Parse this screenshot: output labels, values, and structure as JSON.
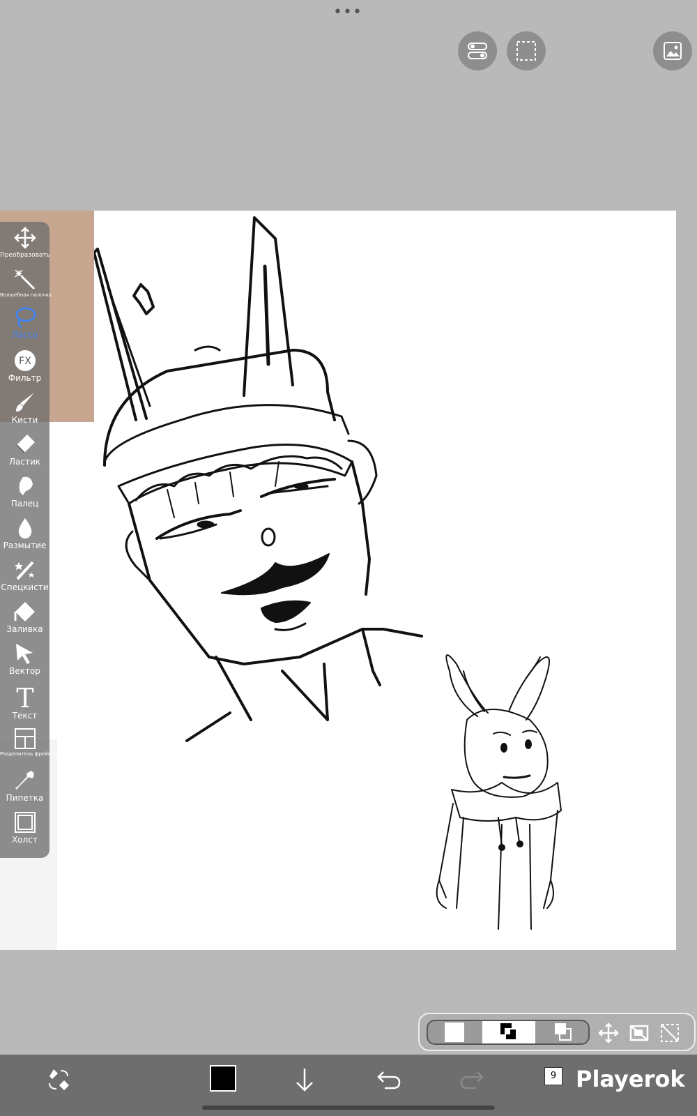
{
  "top": {
    "more_label": "•••"
  },
  "tools": [
    {
      "label": "Преобразовать",
      "icon": "transform-icon"
    },
    {
      "label": "Волшебная палочка",
      "icon": "magic-wand-icon",
      "small": true
    },
    {
      "label": "Лассо",
      "icon": "lasso-icon",
      "active": true
    },
    {
      "label": "Фильтр",
      "icon": "fx-icon"
    },
    {
      "label": "Кисти",
      "icon": "brush-icon"
    },
    {
      "label": "Ластик",
      "icon": "eraser-icon"
    },
    {
      "label": "Палец",
      "icon": "smudge-finger-icon"
    },
    {
      "label": "Размытие",
      "icon": "blur-drop-icon"
    },
    {
      "label": "Спецкисти",
      "icon": "special-brush-icon"
    },
    {
      "label": "Заливка",
      "icon": "fill-bucket-icon"
    },
    {
      "label": "Вектор",
      "icon": "vector-cursor-icon"
    },
    {
      "label": "Текст",
      "icon": "text-icon"
    },
    {
      "label": "Разделитель фреймов",
      "icon": "frame-divider-icon",
      "small": true
    },
    {
      "label": "Пипетка",
      "icon": "eyedropper-icon"
    },
    {
      "label": "Холст",
      "icon": "canvas-icon"
    }
  ],
  "bottom": {
    "layer_count": "9",
    "watermark": "Playerok",
    "primary_color": "#000000"
  },
  "colors": {
    "accent": "#3a86ff",
    "toolbar": "#6e6e6e",
    "background": "#b9b9b9"
  }
}
